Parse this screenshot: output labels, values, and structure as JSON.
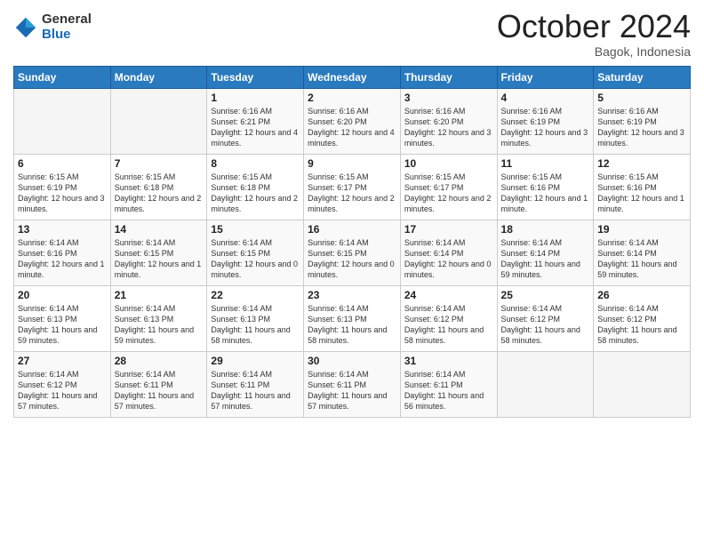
{
  "header": {
    "logo_general": "General",
    "logo_blue": "Blue",
    "month_title": "October 2024",
    "location": "Bagok, Indonesia"
  },
  "days_of_week": [
    "Sunday",
    "Monday",
    "Tuesday",
    "Wednesday",
    "Thursday",
    "Friday",
    "Saturday"
  ],
  "weeks": [
    [
      {
        "day": "",
        "info": ""
      },
      {
        "day": "",
        "info": ""
      },
      {
        "day": "1",
        "info": "Sunrise: 6:16 AM\nSunset: 6:21 PM\nDaylight: 12 hours and 4 minutes."
      },
      {
        "day": "2",
        "info": "Sunrise: 6:16 AM\nSunset: 6:20 PM\nDaylight: 12 hours and 4 minutes."
      },
      {
        "day": "3",
        "info": "Sunrise: 6:16 AM\nSunset: 6:20 PM\nDaylight: 12 hours and 3 minutes."
      },
      {
        "day": "4",
        "info": "Sunrise: 6:16 AM\nSunset: 6:19 PM\nDaylight: 12 hours and 3 minutes."
      },
      {
        "day": "5",
        "info": "Sunrise: 6:16 AM\nSunset: 6:19 PM\nDaylight: 12 hours and 3 minutes."
      }
    ],
    [
      {
        "day": "6",
        "info": "Sunrise: 6:15 AM\nSunset: 6:19 PM\nDaylight: 12 hours and 3 minutes."
      },
      {
        "day": "7",
        "info": "Sunrise: 6:15 AM\nSunset: 6:18 PM\nDaylight: 12 hours and 2 minutes."
      },
      {
        "day": "8",
        "info": "Sunrise: 6:15 AM\nSunset: 6:18 PM\nDaylight: 12 hours and 2 minutes."
      },
      {
        "day": "9",
        "info": "Sunrise: 6:15 AM\nSunset: 6:17 PM\nDaylight: 12 hours and 2 minutes."
      },
      {
        "day": "10",
        "info": "Sunrise: 6:15 AM\nSunset: 6:17 PM\nDaylight: 12 hours and 2 minutes."
      },
      {
        "day": "11",
        "info": "Sunrise: 6:15 AM\nSunset: 6:16 PM\nDaylight: 12 hours and 1 minute."
      },
      {
        "day": "12",
        "info": "Sunrise: 6:15 AM\nSunset: 6:16 PM\nDaylight: 12 hours and 1 minute."
      }
    ],
    [
      {
        "day": "13",
        "info": "Sunrise: 6:14 AM\nSunset: 6:16 PM\nDaylight: 12 hours and 1 minute."
      },
      {
        "day": "14",
        "info": "Sunrise: 6:14 AM\nSunset: 6:15 PM\nDaylight: 12 hours and 1 minute."
      },
      {
        "day": "15",
        "info": "Sunrise: 6:14 AM\nSunset: 6:15 PM\nDaylight: 12 hours and 0 minutes."
      },
      {
        "day": "16",
        "info": "Sunrise: 6:14 AM\nSunset: 6:15 PM\nDaylight: 12 hours and 0 minutes."
      },
      {
        "day": "17",
        "info": "Sunrise: 6:14 AM\nSunset: 6:14 PM\nDaylight: 12 hours and 0 minutes."
      },
      {
        "day": "18",
        "info": "Sunrise: 6:14 AM\nSunset: 6:14 PM\nDaylight: 11 hours and 59 minutes."
      },
      {
        "day": "19",
        "info": "Sunrise: 6:14 AM\nSunset: 6:14 PM\nDaylight: 11 hours and 59 minutes."
      }
    ],
    [
      {
        "day": "20",
        "info": "Sunrise: 6:14 AM\nSunset: 6:13 PM\nDaylight: 11 hours and 59 minutes."
      },
      {
        "day": "21",
        "info": "Sunrise: 6:14 AM\nSunset: 6:13 PM\nDaylight: 11 hours and 59 minutes."
      },
      {
        "day": "22",
        "info": "Sunrise: 6:14 AM\nSunset: 6:13 PM\nDaylight: 11 hours and 58 minutes."
      },
      {
        "day": "23",
        "info": "Sunrise: 6:14 AM\nSunset: 6:13 PM\nDaylight: 11 hours and 58 minutes."
      },
      {
        "day": "24",
        "info": "Sunrise: 6:14 AM\nSunset: 6:12 PM\nDaylight: 11 hours and 58 minutes."
      },
      {
        "day": "25",
        "info": "Sunrise: 6:14 AM\nSunset: 6:12 PM\nDaylight: 11 hours and 58 minutes."
      },
      {
        "day": "26",
        "info": "Sunrise: 6:14 AM\nSunset: 6:12 PM\nDaylight: 11 hours and 58 minutes."
      }
    ],
    [
      {
        "day": "27",
        "info": "Sunrise: 6:14 AM\nSunset: 6:12 PM\nDaylight: 11 hours and 57 minutes."
      },
      {
        "day": "28",
        "info": "Sunrise: 6:14 AM\nSunset: 6:11 PM\nDaylight: 11 hours and 57 minutes."
      },
      {
        "day": "29",
        "info": "Sunrise: 6:14 AM\nSunset: 6:11 PM\nDaylight: 11 hours and 57 minutes."
      },
      {
        "day": "30",
        "info": "Sunrise: 6:14 AM\nSunset: 6:11 PM\nDaylight: 11 hours and 57 minutes."
      },
      {
        "day": "31",
        "info": "Sunrise: 6:14 AM\nSunset: 6:11 PM\nDaylight: 11 hours and 56 minutes."
      },
      {
        "day": "",
        "info": ""
      },
      {
        "day": "",
        "info": ""
      }
    ]
  ]
}
